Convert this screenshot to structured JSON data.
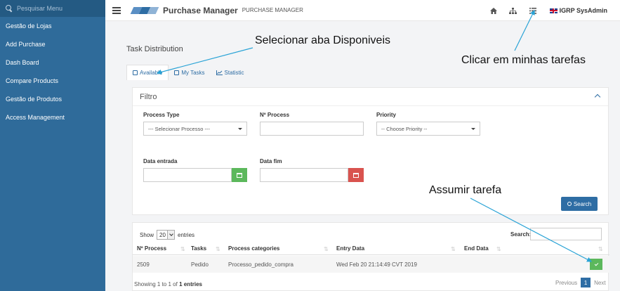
{
  "sidebar": {
    "search_placeholder": "Pesquisar Menu",
    "items": [
      {
        "label": "Gestão de Lojas"
      },
      {
        "label": "Add Purchase"
      },
      {
        "label": "Dash Board"
      },
      {
        "label": "Compare Products"
      },
      {
        "label": "Gestão de Produtos"
      },
      {
        "label": "Access Management"
      }
    ]
  },
  "header": {
    "title": "Purchase Manager",
    "subtitle": "PURCHASE MANAGER",
    "user": "IGRP SysAdmin",
    "icons": [
      "home-icon",
      "sitemap-icon",
      "tasks-list-icon",
      "uk-flag-icon"
    ]
  },
  "main": {
    "page_title": "Task Distribution",
    "tabs": [
      {
        "label": "Available",
        "icon": "calendar-icon"
      },
      {
        "label": "My Tasks",
        "icon": "user-card-icon"
      },
      {
        "label": "Statistic",
        "icon": "line-chart-icon"
      }
    ]
  },
  "filter": {
    "title": "Filtro",
    "process_type_label": "Process Type",
    "process_type_value": "--- Selecionar Processo ---",
    "nprocess_label": "Nº Process",
    "nprocess_value": "",
    "priority_label": "Priority",
    "priority_value": "-- Choose Priority --",
    "data_entrada_label": "Data entrada",
    "data_fim_label": "Data fim",
    "search_button": "Search"
  },
  "table": {
    "show_label": "Show",
    "page_size": "20",
    "entries_label": "entries",
    "search_label": "Search:",
    "columns": [
      "Nº Process",
      "Tasks",
      "Process categories",
      "Entry Data",
      "End Data"
    ],
    "rows": [
      {
        "nprocess": "2509",
        "task": "Pedido",
        "category": "Processo_pedido_compra",
        "entry": "Wed Feb 20 21:14:49 CVT 2019",
        "end": ""
      }
    ],
    "showing_prefix": "Showing 1 to 1 of",
    "showing_count": "1 entries",
    "pager": {
      "previous": "Previous",
      "page": "1",
      "next": "Next"
    }
  },
  "annotations": {
    "select_tab": "Selecionar aba Disponiveis",
    "my_tasks": "Clicar em minhas tarefas",
    "take_task": "Assumir tarefa"
  },
  "colors": {
    "sidebar": "#2f6b9a",
    "accent": "#2e6da4",
    "success": "#5cb85c",
    "danger": "#d9534f"
  }
}
